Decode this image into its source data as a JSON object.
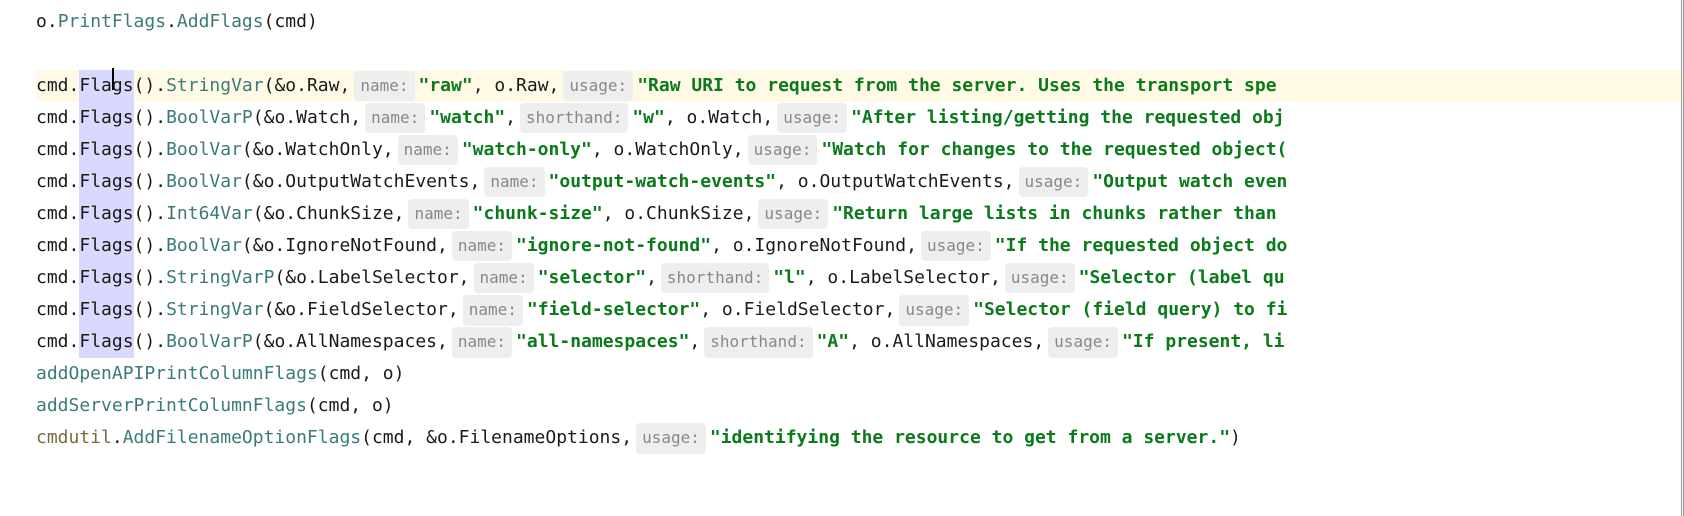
{
  "lines": {
    "l0": {
      "t1": "o.",
      "t2": "PrintFlags",
      "t3": ".",
      "t4": "AddFlags",
      "t5": "(cmd)"
    },
    "l1": {
      "t1": "cmd.",
      "flaA": "Fla",
      "flaB": "gs",
      "t2": "().",
      "t3": "StringVar",
      "t4": "(&o.Raw, ",
      "h1": "name:",
      "s1": "\"raw\"",
      "t5": ", o.Raw, ",
      "h2": "usage:",
      "s2": "\"Raw URI to request from the server.  Uses the transport spe"
    },
    "l2": {
      "t1": "cmd.",
      "fla": "Flags",
      "t2": "().",
      "t3": "BoolVarP",
      "t4": "(&o.Watch, ",
      "h1": "name:",
      "s1": "\"watch\"",
      "t5": ", ",
      "h2": "shorthand:",
      "s2": "\"w\"",
      "t6": ", o.Watch, ",
      "h3": "usage:",
      "s3": "\"After listing/getting the requested obj"
    },
    "l3": {
      "t1": "cmd.",
      "fla": "Flags",
      "t2": "().",
      "t3": "BoolVar",
      "t4": "(&o.WatchOnly, ",
      "h1": "name:",
      "s1": "\"watch-only\"",
      "t5": ", o.WatchOnly, ",
      "h2": "usage:",
      "s2": "\"Watch for changes to the requested object("
    },
    "l4": {
      "t1": "cmd.",
      "fla": "Flags",
      "t2": "().",
      "t3": "BoolVar",
      "t4": "(&o.OutputWatchEvents, ",
      "h1": "name:",
      "s1": "\"output-watch-events\"",
      "t5": ", o.OutputWatchEvents, ",
      "h2": "usage:",
      "s2": "\"Output watch even"
    },
    "l5": {
      "t1": "cmd.",
      "fla": "Flags",
      "t2": "().",
      "t3": "Int64Var",
      "t4": "(&o.ChunkSize, ",
      "h1": "name:",
      "s1": "\"chunk-size\"",
      "t5": ", o.ChunkSize, ",
      "h2": "usage:",
      "s2": "\"Return large lists in chunks rather than "
    },
    "l6": {
      "t1": "cmd.",
      "fla": "Flags",
      "t2": "().",
      "t3": "BoolVar",
      "t4": "(&o.IgnoreNotFound, ",
      "h1": "name:",
      "s1": "\"ignore-not-found\"",
      "t5": ", o.IgnoreNotFound, ",
      "h2": "usage:",
      "s2": "\"If the requested object do"
    },
    "l7": {
      "t1": "cmd.",
      "fla": "Flags",
      "t2": "().",
      "t3": "StringVarP",
      "t4": "(&o.LabelSelector, ",
      "h1": "name:",
      "s1": "\"selector\"",
      "t5": ", ",
      "h2": "shorthand:",
      "s2": "\"l\"",
      "t6": ", o.LabelSelector, ",
      "h3": "usage:",
      "s3": "\"Selector (label qu"
    },
    "l8": {
      "t1": "cmd.",
      "fla": "Flags",
      "t2": "().",
      "t3": "StringVar",
      "t4": "(&o.FieldSelector, ",
      "h1": "name:",
      "s1": "\"field-selector\"",
      "t5": ", o.FieldSelector, ",
      "h2": "usage:",
      "s2": "\"Selector (field query) to fi"
    },
    "l9": {
      "t1": "cmd.",
      "fla": "Flags",
      "t2": "().",
      "t3": "BoolVarP",
      "t4": "(&o.AllNamespaces, ",
      "h1": "name:",
      "s1": "\"all-namespaces\"",
      "t5": ", ",
      "h2": "shorthand:",
      "s2": "\"A\"",
      "t6": ", o.AllNamespaces, ",
      "h3": "usage:",
      "s3": "\"If present, li"
    },
    "l10": {
      "t1": "addOpenAPIPrintColumnFlags",
      "t2": "(cmd, o)"
    },
    "l11": {
      "t1": "addServerPrintColumnFlags",
      "t2": "(cmd, o)"
    },
    "l12": {
      "t1": "cmdutil",
      "t2": ".",
      "t3": "AddFilenameOptionFlags",
      "t4": "(cmd, &o.FilenameOptions, ",
      "h1": "usage:",
      "s1": "\"identifying the resource to get from a server.\"",
      "t5": ")"
    }
  }
}
